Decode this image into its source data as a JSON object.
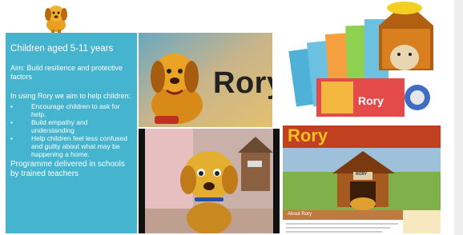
{
  "panel": {
    "heading": "Children aged 5-11 years",
    "aim": "Aim: Build resilience and protective factors",
    "intro": "In using Rory we aim to help children:",
    "bullets": [
      "Encourage children to ask for help.",
      "Build empathy and understanding",
      "Help children feel less confused and guilty about what may be happening a home."
    ],
    "footer": "Programme delivered in schools by trained teachers"
  },
  "images": {
    "title_card_text": "Rory",
    "product_label": "Rory",
    "website_header": "Rory",
    "website_about": "About Rory",
    "doghouse_sign": "RORY"
  },
  "colors": {
    "panel_bg": "#45b4cf",
    "dog_gold": "#e8a020"
  }
}
